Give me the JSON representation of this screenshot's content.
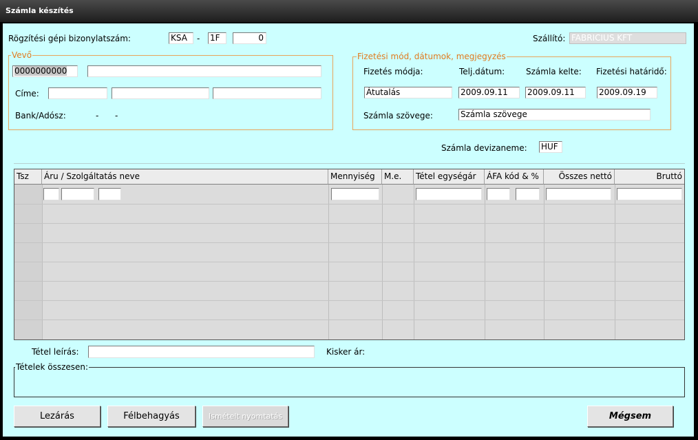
{
  "window": {
    "title": "Számla készítés"
  },
  "header": {
    "doc_number_label": "Rögzítési gépi bizonylatszám:",
    "doc_prefix": "KSA",
    "doc_dash": "-",
    "doc_series": "1F",
    "doc_number": "0",
    "supplier_label": "Szállító:",
    "supplier_value": "FABRICIUS KFT"
  },
  "buyer": {
    "legend": "Vevő",
    "code": "0000000000",
    "name": "",
    "address_label": "Címe:",
    "address": [
      "",
      "",
      ""
    ],
    "bank_label": "Bank/Adósz:",
    "bank_value1": "-",
    "bank_value2": "-"
  },
  "payment": {
    "legend": "Fizetési mód, dátumok, megjegyzés",
    "method_label": "Fizetés módja:",
    "perf_date_label": "Telj.dátum:",
    "invoice_date_label": "Számla kelte:",
    "due_date_label": "Fizetési határidő:",
    "method": "Átutalás",
    "perf_date": "2009.09.11",
    "invoice_date": "2009.09.11",
    "due_date": "2009.09.19",
    "text_label": "Számla szövege:",
    "text_value": "Számla szövege"
  },
  "currency": {
    "label": "Számla devizaneme:",
    "value": "HUF"
  },
  "items_table": {
    "columns": [
      "Tsz",
      "Áru / Szolgáltatás neve",
      "Mennyiség",
      "M.e.",
      "Tétel egységár",
      "ÁFA kód & %",
      "Összes nettó",
      "Bruttó"
    ]
  },
  "footer": {
    "item_desc_label": "Tétel leírás:",
    "item_desc_value": "",
    "retail_price_label": "Kisker ár:",
    "totals_legend": "Tételek összesen:"
  },
  "buttons": {
    "close": "Lezárás",
    "suspend": "Félbehagyás",
    "reprint": "Ismételt nyomtatás",
    "cancel": "Mégsem"
  }
}
